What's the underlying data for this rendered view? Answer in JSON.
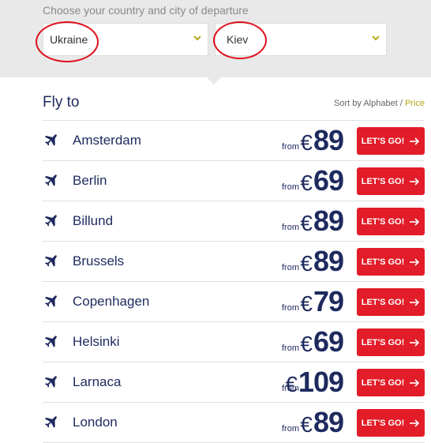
{
  "departure": {
    "label": "Choose your country and city of departure",
    "country": "Ukraine",
    "city": "Kiev"
  },
  "fly_to": {
    "title": "Fly to",
    "sort_label": "Sort by Alphabet",
    "sort_sep": "/",
    "sort_price": "Price"
  },
  "destinations": [
    {
      "city": "Amsterdam",
      "from": "from",
      "currency": "€",
      "price": "89",
      "cta": "LET'S GO!"
    },
    {
      "city": "Berlin",
      "from": "from",
      "currency": "€",
      "price": "69",
      "cta": "LET'S GO!"
    },
    {
      "city": "Billund",
      "from": "from",
      "currency": "€",
      "price": "89",
      "cta": "LET'S GO!"
    },
    {
      "city": "Brussels",
      "from": "from",
      "currency": "€",
      "price": "89",
      "cta": "LET'S GO!"
    },
    {
      "city": "Copenhagen",
      "from": "from",
      "currency": "€",
      "price": "79",
      "cta": "LET'S GO!"
    },
    {
      "city": "Helsinki",
      "from": "from",
      "currency": "€",
      "price": "69",
      "cta": "LET'S GO!"
    },
    {
      "city": "Larnaca",
      "from": "from",
      "currency": "€",
      "price": "109",
      "cta": "LET'S GO!"
    },
    {
      "city": "London",
      "from": "from",
      "currency": "€",
      "price": "89",
      "cta": "LET'S GO!"
    }
  ],
  "icons": {
    "destination_icon": "airplane-icon",
    "select_icon": "chevron-down-icon",
    "button_icon": "arrow-right-icon"
  },
  "colors": {
    "brand_navy": "#1e2a5e",
    "cta_red": "#e21c28",
    "accent_olive": "#b5a917",
    "annotation_red": "#e0101b"
  }
}
